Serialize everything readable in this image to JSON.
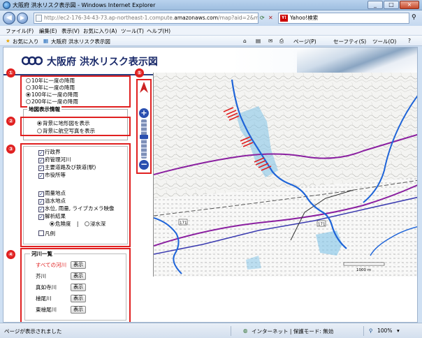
{
  "window": {
    "title": "大阪府 洪水リスク表示図 - Windows Internet Explorer",
    "min": "_",
    "max": "□",
    "close": "×"
  },
  "address": {
    "url_prefix": "http://ec2-176-34-43-73.ap-northeast-1.compute.",
    "url_domain": "amazonaws.com",
    "url_suffix": "/map?aid=2&mid=2",
    "search_label": "Yahoo!検索"
  },
  "menu": [
    "ファイル(F)",
    "編集(E)",
    "表示(V)",
    "お気に入り(A)",
    "ツール(T)",
    "ヘルプ(H)"
  ],
  "favorites": {
    "label": "お気に入り",
    "tab": "大阪府 洪水リスク表示図"
  },
  "commandbar": [
    "ページ(P)",
    "セーフティ(S)",
    "ツール(O)"
  ],
  "header": {
    "title": "大阪府 洪水リスク表示図"
  },
  "markers": [
    "①",
    "②",
    "③",
    "④",
    "⑤"
  ],
  "rain": {
    "options": [
      "10年に一度の降雨",
      "30年に一度の降雨",
      "100年に一度の降雨",
      "200年に一度の降雨"
    ],
    "selected": 2
  },
  "mapdisplay": {
    "legend": "地図表示情報",
    "options": [
      "背景に地形図を表示",
      "背景に航空写真を表示"
    ],
    "selected": 0
  },
  "layers": {
    "group1": [
      "行政界",
      "府管理河川",
      "主要道路及び鉄道(駅)",
      "市役所等"
    ],
    "group2": [
      "雨量地点",
      "溢水地点",
      "水位, 雨量, ライブカメラ映像",
      "解析結果"
    ],
    "analysis": {
      "opt1": "危険度",
      "divider": "|",
      "opt2": "浸水深"
    },
    "legend_item": "凡例"
  },
  "rivers": {
    "legend": "河川一覧",
    "items": [
      "すべての河川",
      "芥川",
      "真如寺川",
      "檜尾川",
      "東檜尾川"
    ],
    "show_label": "表示"
  },
  "map": {
    "scale": "1000 m",
    "road_badges": [
      "171",
      "171"
    ]
  },
  "status": {
    "text": "ページが表示されました",
    "zone": "インターネット | 保護モード: 無効",
    "zoom": "100%"
  },
  "colors": {
    "accent": "#e02020",
    "river": "#1e64d8",
    "boundary": "#8a1fa0",
    "road": "#3a3ab0"
  }
}
